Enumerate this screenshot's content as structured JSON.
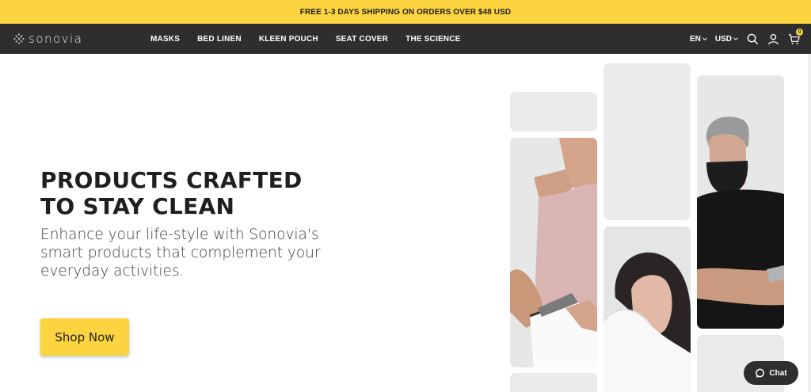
{
  "promo": {
    "text": "FREE 1-3 DAYS SHIPPING ON ORDERS OVER $48 USD"
  },
  "header": {
    "logo_text": "sonovia",
    "nav": [
      "MASKS",
      "BED LINEN",
      "KLEEN POUCH",
      "SEAT COVER",
      "THE SCIENCE"
    ],
    "language": "EN",
    "currency": "USD",
    "cart_count": "0",
    "icons": [
      "search-icon",
      "user-icon",
      "cart-icon"
    ]
  },
  "hero": {
    "title_line1": "PRODUCTS CRAFTED",
    "title_line2": "TO STAY CLEAN",
    "subtitle": "Enhance your life-style with Sonovia's smart products that complement your everyday activities.",
    "cta_label": "Shop Now"
  },
  "chat": {
    "label": "Chat"
  },
  "colors": {
    "accent": "#fcd440",
    "nav_bg": "#2e2e2e",
    "tile_bg": "#e9eceb"
  }
}
